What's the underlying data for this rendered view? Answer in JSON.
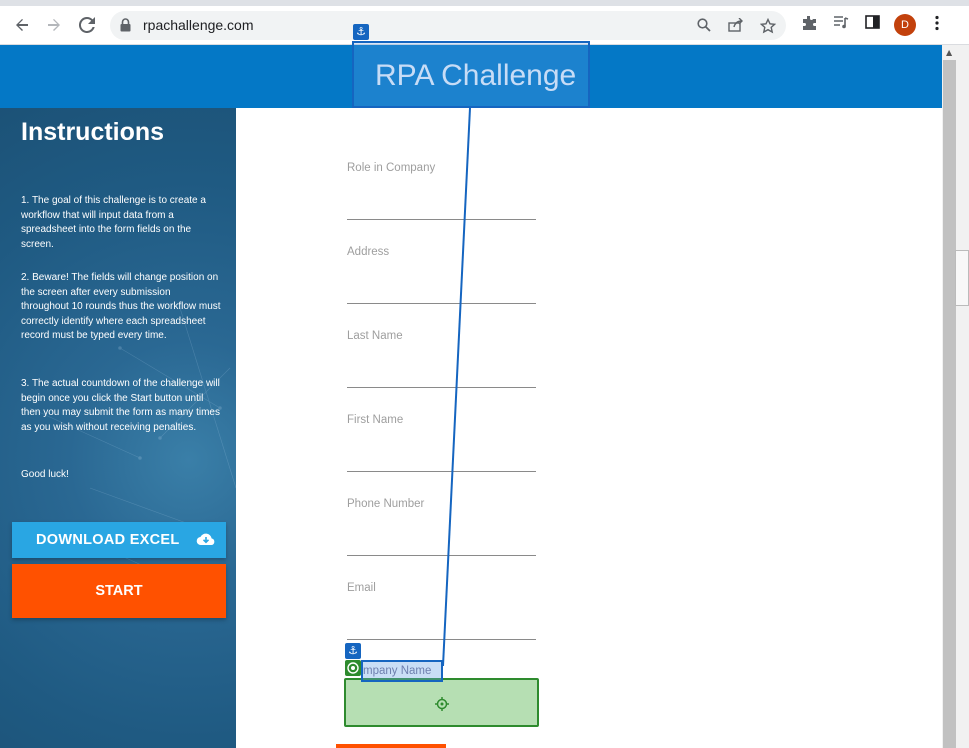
{
  "browser": {
    "url": "rpachallenge.com",
    "avatar_initial": "D"
  },
  "header": {
    "title": "RPA Challenge"
  },
  "sidebar": {
    "heading": "Instructions",
    "paragraphs": [
      "1. The goal of this challenge is to create a workflow that will input data from a spreadsheet into the form fields on the screen.",
      "2. Beware! The fields will change position on the screen after every submission throughout 10 rounds thus the workflow must correctly identify where each spreadsheet record must be typed every time.",
      "3. The actual countdown of the challenge will begin once you click the Start button until then you may submit the form as many times as you wish without receiving penalties.",
      "Good luck!"
    ],
    "download_label": "DOWNLOAD EXCEL",
    "start_label": "START"
  },
  "form": {
    "fields": [
      "Role in Company",
      "Address",
      "Last Name",
      "First Name",
      "Phone Number",
      "Email",
      "Company Name"
    ]
  },
  "overlay": {
    "target_text": "mpany Name"
  },
  "colors": {
    "header": "#0478c6",
    "download": "#29a6e3",
    "start": "#ff5100",
    "anchor": "#1565c0",
    "target": "#2e8b2e"
  }
}
